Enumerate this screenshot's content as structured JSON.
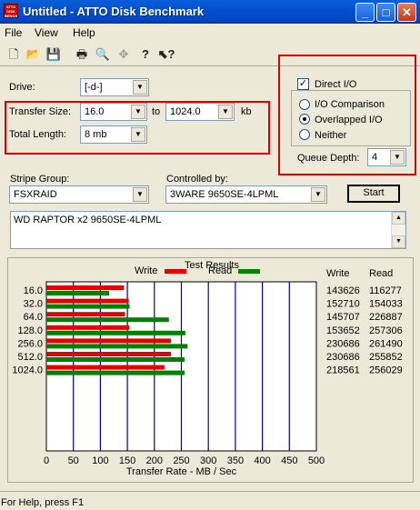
{
  "window": {
    "title": "Untitled - ATTO Disk Benchmark",
    "icon_text": "ATTO DISK BENCH"
  },
  "menu": [
    "File",
    "View",
    "Help"
  ],
  "toolbar": {
    "icons": [
      "new-file-icon",
      "open-folder-icon",
      "save-icon",
      "print-icon",
      "print-preview-icon",
      "move-icon",
      "help-icon",
      "context-help-icon"
    ]
  },
  "drive": {
    "label": "Drive:",
    "value": "[-d-]"
  },
  "transfer": {
    "label": "Transfer Size:",
    "from": "16.0",
    "to_label": "to",
    "to": "1024.0",
    "unit": "kb"
  },
  "total_length": {
    "label": "Total Length:",
    "value": "8 mb"
  },
  "direct_io": {
    "label": "Direct I/O",
    "checked": true
  },
  "io_options": {
    "comparison": "I/O Comparison",
    "overlapped": "Overlapped I/O",
    "neither": "Neither",
    "selected": "Overlapped I/O"
  },
  "queue": {
    "label": "Queue Depth:",
    "value": "4"
  },
  "stripe": {
    "label": "Stripe Group:",
    "value": "FSXRAID"
  },
  "controlled": {
    "label": "Controlled by:",
    "value": "3WARE 9650SE-4LPML"
  },
  "start_label": "Start",
  "description": "WD RAPTOR x2 9650SE-4LPML",
  "results": {
    "title": "Test Results",
    "write_label": "Write",
    "read_label": "Read",
    "col_write": "Write",
    "col_read": "Read",
    "xlabel": "Transfer Rate - MB / Sec",
    "colors": {
      "write": "#e00000",
      "read": "#008000"
    }
  },
  "chart_data": {
    "type": "bar",
    "title": "Test Results",
    "xlabel": "Transfer Rate - MB / Sec",
    "xlim": [
      0,
      500
    ],
    "x_ticks": [
      "0",
      "50",
      "100",
      "150",
      "200",
      "250",
      "300",
      "350",
      "400",
      "450",
      "500"
    ],
    "categories": [
      "16.0",
      "32.0",
      "64.0",
      "128.0",
      "256.0",
      "512.0",
      "1024.0"
    ],
    "series": [
      {
        "name": "Write",
        "values": [
          143626,
          152710,
          145707,
          153652,
          230686,
          230686,
          218561
        ]
      },
      {
        "name": "Read",
        "values": [
          116277,
          154033,
          226887,
          257306,
          261490,
          255852,
          256029
        ]
      }
    ]
  },
  "status": "For Help, press F1"
}
